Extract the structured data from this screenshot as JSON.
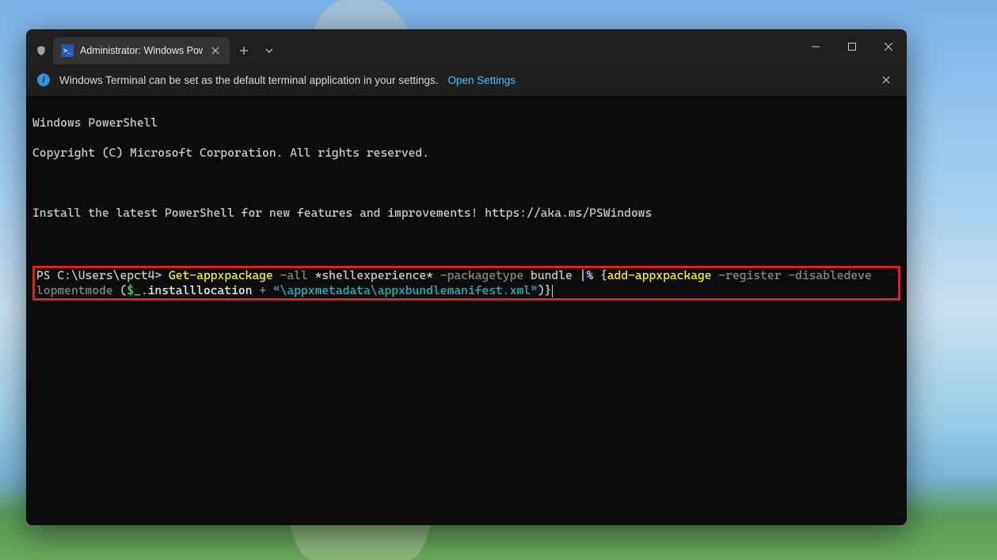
{
  "tab": {
    "label": "Administrator: Windows Powe"
  },
  "infobar": {
    "message": "Windows Terminal can be set as the default terminal application in your settings.",
    "link": "Open Settings"
  },
  "terminal": {
    "line1": "Windows PowerShell",
    "line2": "Copyright (C) Microsoft Corporation. All rights reserved.",
    "line3": "Install the latest PowerShell for new features and improvements! https://aka.ms/PSWindows",
    "prompt": "PS C:\\Users\\epct4> ",
    "tok": {
      "get": "Get-appxpackage",
      "all": " -all",
      "shell": " *shellexperience*",
      "pkgtype": " -packagetype",
      "bundle": " bundle ",
      "pipe": "|",
      "pct": "% ",
      "brace": "{",
      "add": "add-appxpackage",
      "reg": " -register -disabledeve",
      "reg2": "lopmentmode",
      "lp": " (",
      "var": "$_",
      "dot": ".",
      "prop": "installlocation",
      "plus": " + ",
      "str": "“\\appxmetadata\\appxbundlemanifest.xml”",
      "rp": ")",
      "rb": "}"
    }
  }
}
